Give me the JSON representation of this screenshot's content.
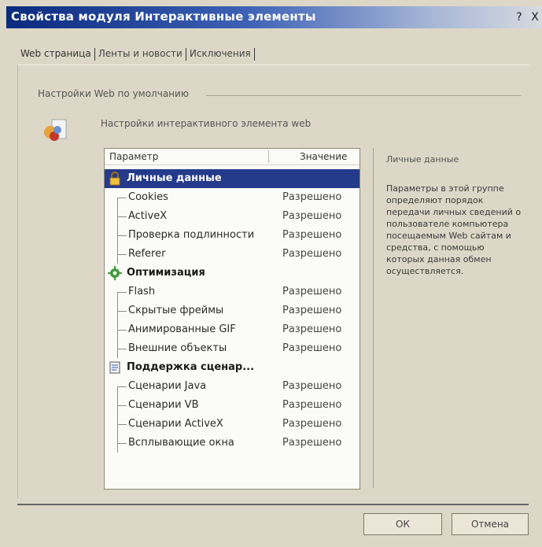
{
  "window": {
    "title": "Свойства модуля Интерактивные элементы",
    "help_btn": "?",
    "close_btn": "X"
  },
  "tabs": [
    {
      "label": "Web страница"
    },
    {
      "label": "Ленты и новости"
    },
    {
      "label": "Исключения"
    }
  ],
  "group": {
    "title": "Настройки Web по умолчанию",
    "description": "Настройки интерактивного элемента web"
  },
  "list": {
    "header_param": "Параметр",
    "header_value": "Значение",
    "rows": [
      {
        "label": "Личные данные",
        "value": "",
        "type": "group",
        "icon": "lock-icon"
      },
      {
        "label": "Cookies",
        "value": "Разрешено",
        "type": "item"
      },
      {
        "label": "ActiveX",
        "value": "Разрешено",
        "type": "item"
      },
      {
        "label": "Проверка подлинности",
        "value": "Разрешено",
        "type": "item"
      },
      {
        "label": "Referer",
        "value": "Разрешено",
        "type": "item"
      },
      {
        "label": "Оптимизация",
        "value": "",
        "type": "group",
        "icon": "gear-icon"
      },
      {
        "label": "Flash",
        "value": "Разрешено",
        "type": "item"
      },
      {
        "label": "Скрытые фреймы",
        "value": "Разрешено",
        "type": "item"
      },
      {
        "label": "Анимированные GIF",
        "value": "Разрешено",
        "type": "item"
      },
      {
        "label": "Внешние объекты",
        "value": "Разрешено",
        "type": "item"
      },
      {
        "label": "Поддержка сценар...",
        "value": "",
        "type": "group",
        "icon": "script-icon"
      },
      {
        "label": "Сценарии Java",
        "value": "Разрешено",
        "type": "item"
      },
      {
        "label": "Сценарии VB",
        "value": "Разрешено",
        "type": "item"
      },
      {
        "label": "Сценарии ActiveX",
        "value": "Разрешено",
        "type": "item"
      },
      {
        "label": "Всплывающие окна",
        "value": "Разрешено",
        "type": "item"
      }
    ]
  },
  "info": {
    "title": "Личные данные",
    "text": "Параметры в этой группе определяют порядок передачи личных сведений о пользователе компьютера посещаемым Web сайтам и средства, с помощью которых данная обмен осуществляется."
  },
  "buttons": {
    "ok": "ОК",
    "cancel": "Отмена"
  }
}
